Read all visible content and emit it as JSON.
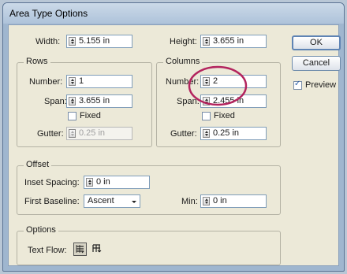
{
  "window": {
    "title": "Area Type Options"
  },
  "size": {
    "width_label": "Width:",
    "width_value": "5.155 in",
    "height_label": "Height:",
    "height_value": "3.655 in"
  },
  "rows": {
    "title": "Rows",
    "number_label": "Number:",
    "number_value": "1",
    "span_label": "Span:",
    "span_value": "3.655 in",
    "fixed_label": "Fixed",
    "gutter_label": "Gutter:",
    "gutter_value": "0.25 in"
  },
  "columns": {
    "title": "Columns",
    "number_label": "Number:",
    "number_value": "2",
    "span_label": "Span:",
    "span_value": "2.455 in",
    "fixed_label": "Fixed",
    "gutter_label": "Gutter:",
    "gutter_value": "0.25 in"
  },
  "offset": {
    "title": "Offset",
    "inset_label": "Inset Spacing:",
    "inset_value": "0 in",
    "baseline_label": "First Baseline:",
    "baseline_value": "Ascent",
    "min_label": "Min:",
    "min_value": "0 in"
  },
  "options": {
    "title": "Options",
    "textflow_label": "Text Flow:"
  },
  "buttons": {
    "ok": "OK",
    "cancel": "Cancel"
  },
  "preview": {
    "label": "Preview",
    "checked": true
  },
  "colors": {
    "highlight_circle": "#b3245e"
  }
}
